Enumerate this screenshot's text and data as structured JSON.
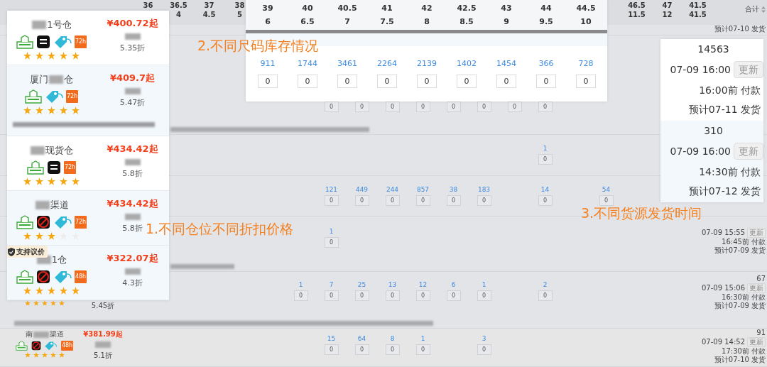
{
  "background_table": {
    "header": {
      "sizes_left": [
        {
          "eu": "36"
        },
        {
          "eu": "36.5",
          "us": "4"
        },
        {
          "eu": "37",
          "us": "4.5"
        },
        {
          "eu": "38",
          "us": "5"
        }
      ],
      "sizes_right": [
        {
          "eu": "46.5",
          "us": "11.5"
        },
        {
          "eu": "47",
          "us": "12"
        },
        {
          "eu": "41.5",
          "us": "41.5"
        }
      ],
      "total_label": "合计"
    },
    "rows": [
      {
        "right": {
          "ship": "预计07-10 发货"
        }
      },
      {
        "note_blurred": true,
        "cells": [
          null,
          null,
          null,
          null,
          null,
          null,
          {
            "qty": "0"
          },
          {
            "qty": "0"
          },
          {
            "qty": "0"
          },
          {
            "qty": "0"
          },
          {
            "qty": "0"
          },
          {
            "qty": "0"
          },
          {
            "qty": "0"
          },
          {
            "qty": "0"
          },
          null,
          null,
          null,
          null,
          null
        ]
      },
      {
        "cells": [
          null,
          null,
          null,
          null,
          null,
          null,
          null,
          null,
          null,
          null,
          null,
          null,
          null,
          {
            "available": "1",
            "qty": "0"
          },
          null,
          null,
          null,
          null,
          null
        ]
      },
      {
        "cells": [
          null,
          null,
          null,
          null,
          null,
          null,
          {
            "available": "121",
            "qty": "0"
          },
          {
            "available": "449",
            "qty": "0"
          },
          {
            "available": "244",
            "qty": "0"
          },
          {
            "available": "857",
            "qty": "0"
          },
          {
            "available": "38",
            "qty": "0"
          },
          {
            "available": "183",
            "qty": "0"
          },
          null,
          {
            "available": "14",
            "qty": "0"
          },
          null,
          {
            "available": "54",
            "qty": "0"
          },
          null,
          null,
          null
        ]
      },
      {
        "note_blurred": true,
        "cells": [
          null,
          null,
          null,
          null,
          null,
          null,
          {
            "available": "1",
            "qty": "0"
          },
          null,
          null,
          null,
          null,
          null,
          null,
          null,
          null,
          null,
          null,
          null,
          null
        ],
        "right": {
          "time": "07-09 15:55",
          "update": "更新",
          "pay": "16:45前 付款",
          "ship": "预计07-09 发货"
        }
      },
      {
        "note_blurred": true,
        "left": {
          "stars": 5,
          "discount": "5.45折"
        },
        "cells": [
          null,
          null,
          null,
          null,
          null,
          {
            "available": "1",
            "qty": "0"
          },
          {
            "available": "7",
            "qty": "0"
          },
          {
            "available": "25",
            "qty": "0"
          },
          {
            "available": "13",
            "qty": "0"
          },
          {
            "available": "12",
            "qty": "0"
          },
          {
            "available": "6",
            "qty": "0"
          },
          {
            "available": "1",
            "qty": "0"
          },
          null,
          {
            "available": "2",
            "qty": "0"
          },
          null,
          null,
          null,
          null,
          null
        ],
        "right": {
          "total": "67",
          "time": "07-09 15:06",
          "update": "更新",
          "pay": "16:30前 付款",
          "ship": "预计07-09 发货"
        }
      },
      {
        "left": {
          "name": [
            {
              "kind": "text",
              "text": "南"
            },
            {
              "kind": "blur"
            },
            {
              "kind": "text",
              "text": "渠道"
            }
          ],
          "badges": [
            {
              "kind": "return"
            },
            {
              "kind": "no-flash"
            },
            {
              "kind": "tag"
            },
            {
              "kind": "ship",
              "label": "48h"
            }
          ],
          "stars": 5,
          "price": "¥381.99起",
          "original_price_blurred": true,
          "discount": "5.1折"
        },
        "cells": [
          null,
          null,
          null,
          null,
          null,
          null,
          {
            "available": "15",
            "qty": "0"
          },
          {
            "available": "64",
            "qty": "0"
          },
          {
            "available": "8",
            "qty": "0"
          },
          {
            "available": "1",
            "qty": "0"
          },
          null,
          {
            "available": "3",
            "qty": "0"
          },
          null,
          null,
          null,
          null,
          null,
          null,
          null
        ],
        "right": {
          "total": "91",
          "time": "07-09 14:52",
          "update": "更新",
          "pay": "17:30前 付款",
          "ship": "预计07-10 发货"
        }
      }
    ]
  },
  "warehouse_panel": {
    "rows": [
      {
        "highlighted": false,
        "name": [
          {
            "kind": "blur"
          },
          {
            "kind": "text",
            "text": "1号仓"
          }
        ],
        "badges": [
          {
            "kind": "return"
          },
          {
            "kind": "flash"
          },
          {
            "kind": "tag"
          },
          {
            "kind": "ship",
            "label": "72h"
          }
        ],
        "stars": 5,
        "price": "¥400.72起",
        "original_price_blurred": true,
        "discount": "5.35折"
      },
      {
        "highlighted": true,
        "note_blurred": true,
        "name": [
          {
            "kind": "text",
            "text": "厦门"
          },
          {
            "kind": "blur"
          },
          {
            "kind": "text",
            "text": "仓"
          }
        ],
        "badges": [
          {
            "kind": "return"
          },
          {
            "kind": "tag"
          },
          {
            "kind": "ship",
            "label": "72h"
          }
        ],
        "stars": 5,
        "price": "¥409.7起",
        "original_price_blurred": true,
        "discount": "5.47折"
      },
      {
        "highlighted": false,
        "name": [
          {
            "kind": "blur"
          },
          {
            "kind": "text",
            "text": "现货仓"
          }
        ],
        "badges": [
          {
            "kind": "return"
          },
          {
            "kind": "flash"
          },
          {
            "kind": "ship",
            "label": "72h"
          }
        ],
        "stars": 5,
        "price": "¥434.42起",
        "original_price_blurred": true,
        "discount": "5.8折"
      },
      {
        "highlighted": true,
        "name": [
          {
            "kind": "blur"
          },
          {
            "kind": "text",
            "text": "渠道"
          }
        ],
        "badges": [
          {
            "kind": "return"
          },
          {
            "kind": "no-flash"
          },
          {
            "kind": "tag"
          },
          {
            "kind": "ship",
            "label": "72h"
          }
        ],
        "stars": 3,
        "price": "¥434.42起",
        "original_price_blurred": true,
        "discount": "5.8折"
      },
      {
        "highlighted": true,
        "tag": "支持议价",
        "name": [
          {
            "kind": "blur"
          },
          {
            "kind": "text",
            "text": "1仓"
          }
        ],
        "badges": [
          {
            "kind": "return"
          },
          {
            "kind": "no-flash"
          },
          {
            "kind": "tag"
          },
          {
            "kind": "ship",
            "label": "48h"
          }
        ],
        "stars": 5,
        "price": "¥322.07起",
        "original_price_blurred": true,
        "discount": "4.3折"
      }
    ]
  },
  "size_panel": {
    "sizes": [
      {
        "eu": "39",
        "us": "6",
        "available": "911",
        "qty": "0"
      },
      {
        "eu": "40",
        "us": "6.5",
        "available": "1744",
        "qty": "0"
      },
      {
        "eu": "40.5",
        "us": "7",
        "available": "3461",
        "qty": "0"
      },
      {
        "eu": "41",
        "us": "7.5",
        "available": "2264",
        "qty": "0"
      },
      {
        "eu": "42",
        "us": "8",
        "available": "2139",
        "qty": "0"
      },
      {
        "eu": "42.5",
        "us": "8.5",
        "available": "1402",
        "qty": "0"
      },
      {
        "eu": "43",
        "us": "9",
        "available": "1454",
        "qty": "0"
      },
      {
        "eu": "44",
        "us": "9.5",
        "available": "366",
        "qty": "0"
      },
      {
        "eu": "44.5",
        "us": "10",
        "available": "728",
        "qty": "0"
      }
    ]
  },
  "ship_panel": {
    "blocks": [
      {
        "highlighted": false,
        "total": "14563",
        "time": "07-09 16:00",
        "update": "更新",
        "pay": "16:00前 付款",
        "ship": "预计07-11 发货"
      },
      {
        "highlighted": true,
        "total": "310",
        "time": "07-09 16:00",
        "update": "更新",
        "pay": "14:30前 付款",
        "ship": "预计07-12 发货"
      }
    ]
  },
  "annotations": [
    "2.不同尺码库存情况",
    "1.不同仓位不同折扣价格",
    "3.不同货源发货时间"
  ]
}
